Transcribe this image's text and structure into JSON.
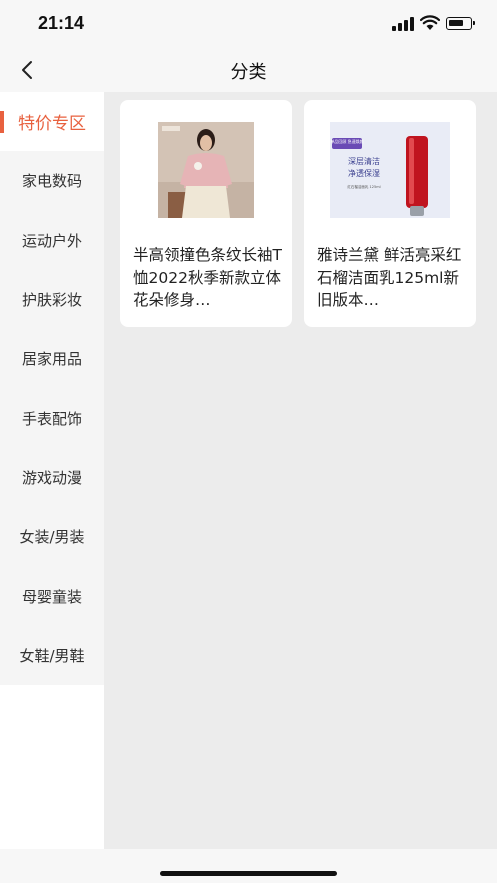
{
  "status_bar": {
    "time": "21:14"
  },
  "nav": {
    "title": "分类"
  },
  "sidebar": {
    "active_index": 0,
    "items": [
      {
        "label": "特价专区"
      },
      {
        "label": "家电数码"
      },
      {
        "label": "运动户外"
      },
      {
        "label": "护肤彩妆"
      },
      {
        "label": "居家用品"
      },
      {
        "label": "手表配饰"
      },
      {
        "label": "游戏动漫"
      },
      {
        "label": "女装/男装"
      },
      {
        "label": "母婴童装"
      },
      {
        "label": "女鞋/男鞋"
      }
    ]
  },
  "products": [
    {
      "title": "半高领撞色条纹长袖T恤2022秋季新款立体花朵修身…",
      "image": "woman-in-pink-top-photo"
    },
    {
      "title": "雅诗兰黛 鲜活亮采红石榴洁面乳125ml新旧版本…",
      "image": "red-cleanser-tube-photo",
      "image_text": {
        "badge": "单品回顾 急速焕颜",
        "headline1": "深层清洁",
        "headline2": "净透保湿",
        "footer": "红石榴洁面乳 125ml"
      }
    },
    {
      "accent": "#e8613f"
    }
  ]
}
